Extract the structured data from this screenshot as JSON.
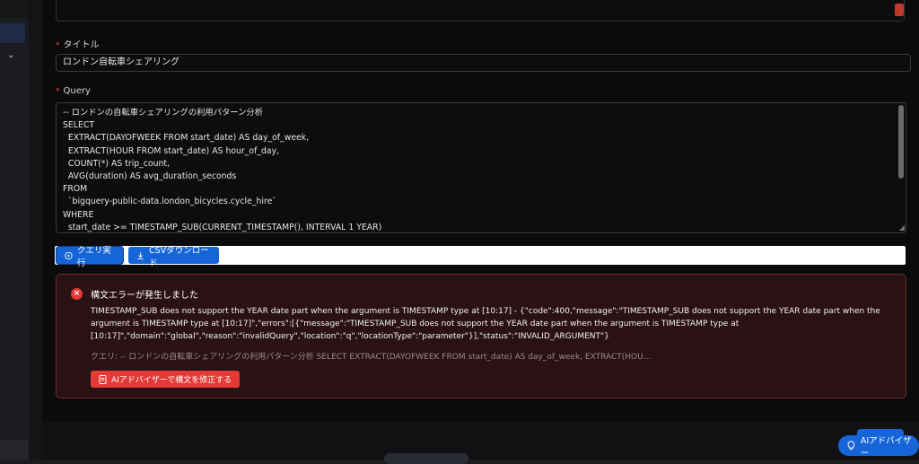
{
  "form": {
    "required_mark": "*",
    "title_label": "タイトル",
    "title_value": "ロンドン自転車シェアリング",
    "query_label": "Query",
    "query_text": "-- ロンドンの自転車シェアリングの利用パターン分析\nSELECT\n  EXTRACT(DAYOFWEEK FROM start_date) AS day_of_week,\n  EXTRACT(HOUR FROM start_date) AS hour_of_day,\n  COUNT(*) AS trip_count,\n  AVG(duration) AS avg_duration_seconds\nFROM\n  `bigquery-public-data.london_bicycles.cycle_hire`\nWHERE\n  start_date >= TIMESTAMP_SUB(CURRENT_TIMESTAMP(), INTERVAL 1 YEAR)"
  },
  "actions": {
    "run_label": "クエリ実行",
    "csv_label": "CSVダウンロード"
  },
  "error": {
    "title": "構文エラーが発生しました",
    "message": "TIMESTAMP_SUB does not support the YEAR date part when the argument is TIMESTAMP type at [10:17] - {\"code\":400,\"message\":\"TIMESTAMP_SUB does not support the YEAR date part when the argument is TIMESTAMP type at [10:17]\",\"errors\":[{\"message\":\"TIMESTAMP_SUB does not support the YEAR date part when the argument is TIMESTAMP type at [10:17]\",\"domain\":\"global\",\"reason\":\"invalidQuery\",\"location\":\"q\",\"locationType\":\"parameter\"}],\"status\":\"INVALID_ARGUMENT\"}",
    "query_summary": "クエリ: -- ロンドンの自転車シェアリングの利用パターン分析 SELECT EXTRACT(DAYOFWEEK FROM start_date) AS day_of_week, EXTRACT(HOU...",
    "advisor_button": "AIアドバイザーで構文を修正する"
  },
  "floating": {
    "ai_advisor_label": "AIアドバイザー"
  },
  "colors": {
    "accent": "#1565d8",
    "danger": "#e53935"
  }
}
